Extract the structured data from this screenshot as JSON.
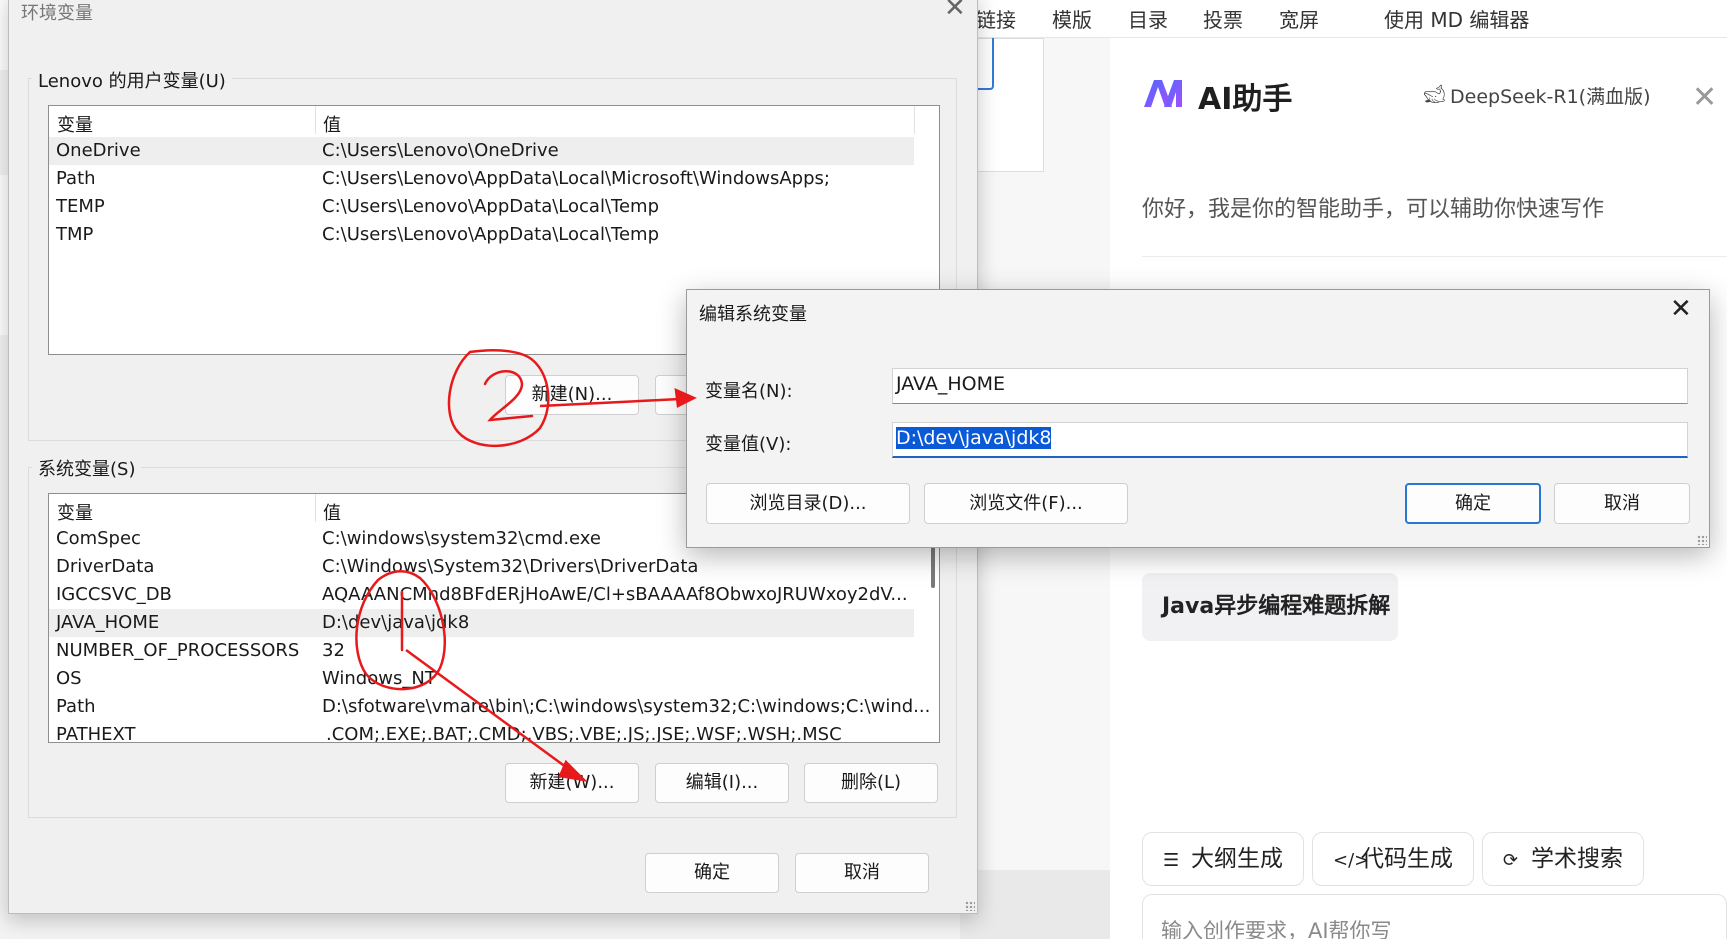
{
  "background_editor": {
    "tabs": [
      "链接",
      "模版",
      "目录",
      "投票",
      "宽屏",
      "使用 MD 编辑器"
    ]
  },
  "ai_assistant": {
    "title": "AI助手",
    "model": "DeepSeek-R1(满血版)",
    "greeting": "你好，我是你的智能助手，可以辅助你快速写作",
    "suggestion": "Java异步编程难题拆解",
    "tools": [
      {
        "label": "大纲生成",
        "icon": "list-icon"
      },
      {
        "label": "代码生成",
        "icon": "code-icon"
      },
      {
        "label": "学术搜索",
        "icon": "search-icon"
      }
    ],
    "input_placeholder": "输入创作要求，AI帮你写",
    "accent_color": "#6e4cf5"
  },
  "env_dialog": {
    "title": "环境变量",
    "user_group_label": "Lenovo 的用户变量(U)",
    "user_vars": {
      "headers": [
        "变量",
        "值"
      ],
      "rows": [
        [
          "OneDrive",
          "C:\\Users\\Lenovo\\OneDrive"
        ],
        [
          "Path",
          "C:\\Users\\Lenovo\\AppData\\Local\\Microsoft\\WindowsApps;"
        ],
        [
          "TEMP",
          "C:\\Users\\Lenovo\\AppData\\Local\\Temp"
        ],
        [
          "TMP",
          "C:\\Users\\Lenovo\\AppData\\Local\\Temp"
        ]
      ],
      "new_button": "新建(N)..."
    },
    "system_group_label": "系统变量(S)",
    "system_vars": {
      "headers": [
        "变量",
        "值"
      ],
      "rows": [
        [
          "ComSpec",
          "C:\\windows\\system32\\cmd.exe"
        ],
        [
          "DriverData",
          "C:\\Windows\\System32\\Drivers\\DriverData"
        ],
        [
          "IGCCSVC_DB",
          "AQAAANCMnd8BFdERjHoAwE/Cl+sBAAAAf8ObwxoJRUWxoy2dV..."
        ],
        [
          "JAVA_HOME",
          "D:\\dev\\java\\jdk8"
        ],
        [
          "NUMBER_OF_PROCESSORS",
          "32"
        ],
        [
          "OS",
          "Windows_NT"
        ],
        [
          "Path",
          "D:\\sfotware\\vmare\\bin\\;C:\\windows\\system32;C:\\windows;C:\\wind..."
        ],
        [
          "PATHEXT",
          ".COM;.EXE;.BAT;.CMD;.VBS;.VBE;.JS;.JSE;.WSF;.WSH;.MSC"
        ]
      ],
      "new_button": "新建(W)...",
      "edit_button": "编辑(I)...",
      "delete_button": "删除(L)"
    },
    "ok_button": "确定",
    "cancel_button": "取消"
  },
  "edit_dialog": {
    "title": "编辑系统变量",
    "name_label": "变量名(N):",
    "name_value": "JAVA_HOME",
    "value_label": "变量值(V):",
    "value_value": "D:\\dev\\java\\jdk8",
    "browse_dir_button": "浏览目录(D)...",
    "browse_file_button": "浏览文件(F)...",
    "ok_button": "确定",
    "cancel_button": "取消"
  },
  "annotation_color": "#e8191b"
}
